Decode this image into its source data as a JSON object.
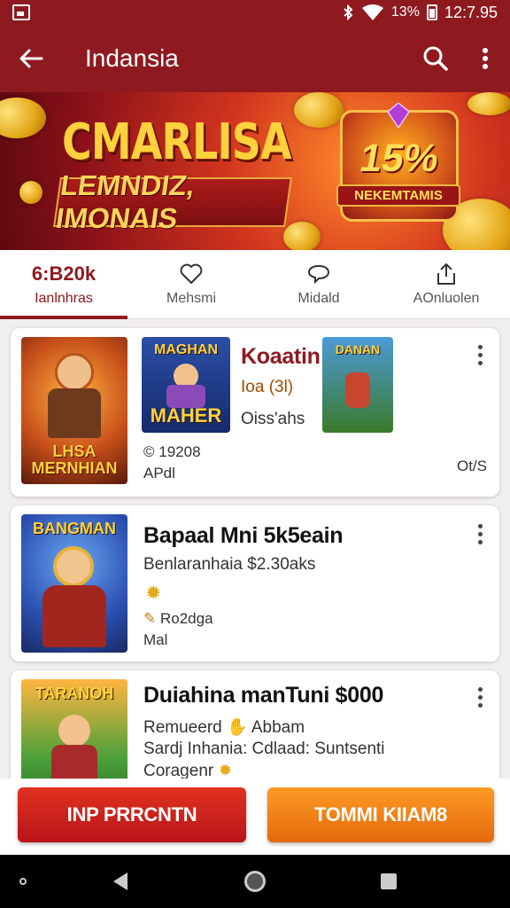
{
  "status_bar": {
    "battery": "13%",
    "time": "12:7.95"
  },
  "app_bar": {
    "title": "Indansia"
  },
  "banner": {
    "title": "CMARLISA",
    "subtitle": "LEMNDIZ, IMONAIS",
    "badge_number": "15%",
    "badge_label": "NEKEMTAMIS"
  },
  "tabs": [
    {
      "top": "6:B20k",
      "label": "Ianlnhras",
      "active": true,
      "icon": "count"
    },
    {
      "top": "",
      "label": "Mehsmi",
      "active": false,
      "icon": "heart-icon"
    },
    {
      "top": "",
      "label": "Midald",
      "active": false,
      "icon": "chat-bubble-icon"
    },
    {
      "top": "",
      "label": "AOnluolen",
      "active": false,
      "icon": "share-icon"
    }
  ],
  "cards": [
    {
      "thumb_caption_top": "LHSA",
      "thumb_caption_bottom": "MERNHIAN",
      "mini1_top": "MAGHAN",
      "mini1_bottom": "MAHER",
      "title": "Koaatin",
      "line1": "Ioa (3l)",
      "line2": "Oiss'ahs",
      "mini2_top": "DANAN",
      "stat": "© 19208",
      "stat2": "APdl",
      "badge": "Ot/S"
    },
    {
      "thumb_caption": "BANGMAN",
      "title": "Bapaal Mni 5k5eain",
      "line1": "Benlaranhaia $2.30aks",
      "line2": "Ro2dga",
      "line3": "Mal"
    },
    {
      "thumb_caption": "TARANOH",
      "title": "Duiahina manTuni $000",
      "line1": "Remueerd ✋ Abbam",
      "line2": "Sardj Inhania: Cdlaad: Suntsenti",
      "line3": "Coragenr"
    }
  ],
  "buttons": {
    "primary": "INP PRRCNTN",
    "secondary": "TOMMI KIIAM8"
  },
  "colors": {
    "brand": "#8e1a20",
    "primary_button": "#c8231c",
    "secondary_button": "#f2820f"
  }
}
